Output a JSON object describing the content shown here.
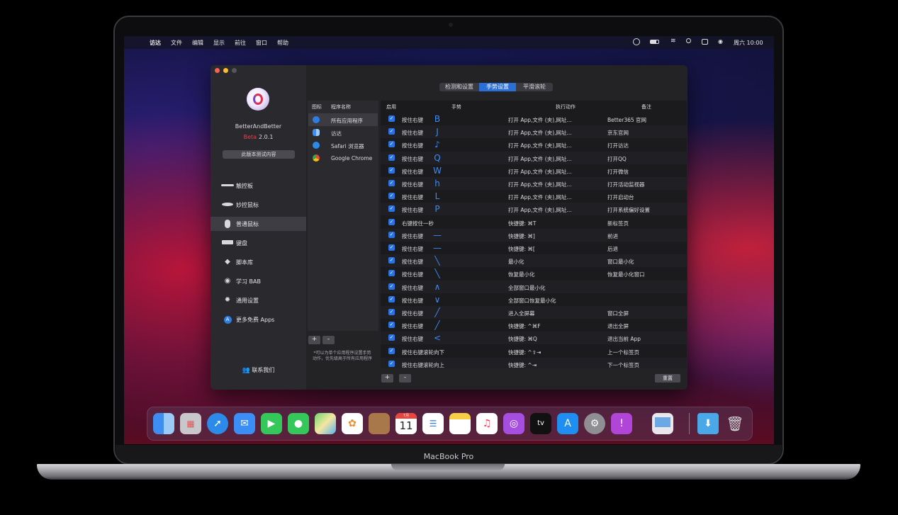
{
  "menubar": {
    "apple": "",
    "items": [
      "访达",
      "文件",
      "编辑",
      "显示",
      "前往",
      "窗口",
      "帮助"
    ],
    "clock": "周六 10:00"
  },
  "sidebar": {
    "app_name": "BetterAndBetter",
    "beta_word": "Beta",
    "version": "2.0.1",
    "beta_button": "此版本测试内容",
    "items": [
      {
        "label": "触控板",
        "icon": "trackpad-icon"
      },
      {
        "label": "妙控鼠标",
        "icon": "magic-mouse-icon"
      },
      {
        "label": "普通鼠标",
        "icon": "mouse-icon"
      },
      {
        "label": "键盘",
        "icon": "keyboard-icon"
      },
      {
        "label": "脚本库",
        "icon": "script-icon"
      },
      {
        "label": "学习 BAB",
        "icon": "learn-icon"
      },
      {
        "label": "通用设置",
        "icon": "gear-icon"
      },
      {
        "label": "更多免费 Apps",
        "icon": "app-store-icon"
      }
    ],
    "contact": "联系我们"
  },
  "tabs": [
    "检测和设置",
    "手势设置",
    "平滑滚轮"
  ],
  "programs": {
    "headers": {
      "icon": "图标",
      "name": "程序名称"
    },
    "rows": [
      {
        "name": "所有应用程序",
        "color": "#2f7de1"
      },
      {
        "name": "访达",
        "color": "#3d8ef0"
      },
      {
        "name": "Safari 浏览器",
        "color": "#2c8ae8"
      },
      {
        "name": "Google Chrome",
        "color": "#e04b3a"
      }
    ],
    "add": "+",
    "remove": "-",
    "note_line1": "*可以为单个应用程序设置手势",
    "note_line2": "动作，优先级高于所有应用程序"
  },
  "table": {
    "headers": {
      "enabled": "启用",
      "gesture": "手势",
      "action": "执行动作",
      "remark": "备注"
    },
    "rows": [
      {
        "trigger": "按住右键",
        "gesture": "B",
        "action": "打开 App,文件 (夹),网址...",
        "remark": "Better365 官网"
      },
      {
        "trigger": "按住右键",
        "gesture": "J",
        "action": "打开 App,文件 (夹),网址...",
        "remark": "京东官网"
      },
      {
        "trigger": "按住右键",
        "gesture": "♪",
        "action": "打开 App,文件 (夹),网址...",
        "remark": "打开访达"
      },
      {
        "trigger": "按住右键",
        "gesture": "Q",
        "action": "打开 App,文件 (夹),网址...",
        "remark": "打开QQ"
      },
      {
        "trigger": "按住右键",
        "gesture": "W",
        "action": "打开 App,文件 (夹),网址...",
        "remark": "打开微信"
      },
      {
        "trigger": "按住右键",
        "gesture": "h",
        "action": "打开 App,文件 (夹),网址...",
        "remark": "打开活动监视器"
      },
      {
        "trigger": "按住右键",
        "gesture": "L",
        "action": "打开 App,文件 (夹),网址...",
        "remark": "打开启动台"
      },
      {
        "trigger": "按住右键",
        "gesture": "P",
        "action": "打开 App,文件 (夹),网址...",
        "remark": "打开系统偏好设置"
      },
      {
        "trigger": "右键按住一秒",
        "gesture": "",
        "action": "快捷键: ⌘T",
        "remark": "新标签页"
      },
      {
        "trigger": "按住右键",
        "gesture": "—",
        "action": "快捷键: ⌘]",
        "remark": "前进"
      },
      {
        "trigger": "按住右键",
        "gesture": "—",
        "action": "快捷键: ⌘[",
        "remark": "后退"
      },
      {
        "trigger": "按住右键",
        "gesture": "╲",
        "action": "最小化",
        "remark": "窗口最小化"
      },
      {
        "trigger": "按住右键",
        "gesture": "╲",
        "action": "恢复最小化",
        "remark": "恢复最小化窗口"
      },
      {
        "trigger": "按住右键",
        "gesture": "∧",
        "action": "全部窗口最小化",
        "remark": ""
      },
      {
        "trigger": "按住右键",
        "gesture": "∨",
        "action": "全部窗口恢复最小化",
        "remark": ""
      },
      {
        "trigger": "按住右键",
        "gesture": "╱",
        "action": "进入全屏幕",
        "remark": "窗口全屏"
      },
      {
        "trigger": "按住右键",
        "gesture": "╱",
        "action": "快捷键: ^⌘F",
        "remark": "退出全屏"
      },
      {
        "trigger": "按住右键",
        "gesture": "<",
        "action": "快捷键: ⌘Q",
        "remark": "退出当前 App"
      },
      {
        "trigger": "按住右键滚轮向下",
        "gesture": "",
        "action": "快捷键: ^⇧⇥",
        "remark": "上一个标签页"
      },
      {
        "trigger": "按住右键滚轮向上",
        "gesture": "",
        "action": "快捷键: ^⇥",
        "remark": "下一个标签页"
      }
    ],
    "add": "+",
    "remove": "-",
    "reset": "重置"
  },
  "dock": {
    "calendar_month": "7月",
    "calendar_day": "11",
    "tv_label": "tv",
    "apps": [
      "finder-icon",
      "launchpad-icon",
      "safari-icon",
      "mail-icon",
      "facetime-icon",
      "messages-icon",
      "maps-icon",
      "photos-icon",
      "contacts-icon",
      "calendar-icon",
      "reminders-icon",
      "notes-icon",
      "music-icon",
      "podcasts-icon",
      "apple-tv-icon",
      "app-store-icon",
      "system-preferences-icon",
      "feedback-icon",
      "preview-icon",
      "downloads-folder-icon",
      "trash-icon"
    ]
  },
  "laptop": {
    "label": "MacBook Pro"
  }
}
